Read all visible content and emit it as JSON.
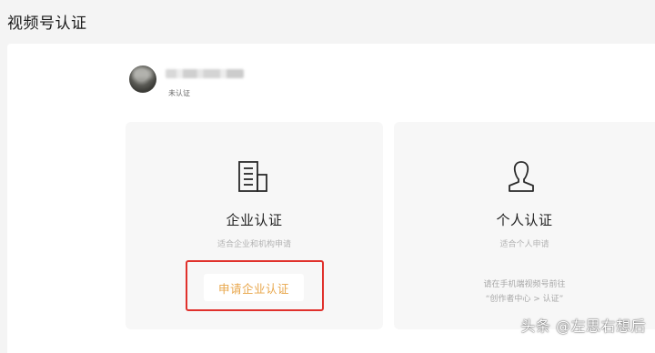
{
  "page": {
    "title": "视频号认证"
  },
  "account": {
    "status": "未认证"
  },
  "options": {
    "enterprise": {
      "icon": "building-icon",
      "title": "企业认证",
      "subtitle": "适合企业和机构申请",
      "button_label": "申请企业认证"
    },
    "personal": {
      "icon": "person-icon",
      "title": "个人认证",
      "subtitle": "适合个人申请",
      "hint_line1": "请在手机端视频号前往",
      "hint_line2": "“创作者中心 > 认证”"
    }
  },
  "watermark": {
    "text": "头条 @左思右想后"
  },
  "colors": {
    "accent": "#e8a64a",
    "highlight": "#e0312c",
    "card_bg": "#f7f7f7"
  }
}
